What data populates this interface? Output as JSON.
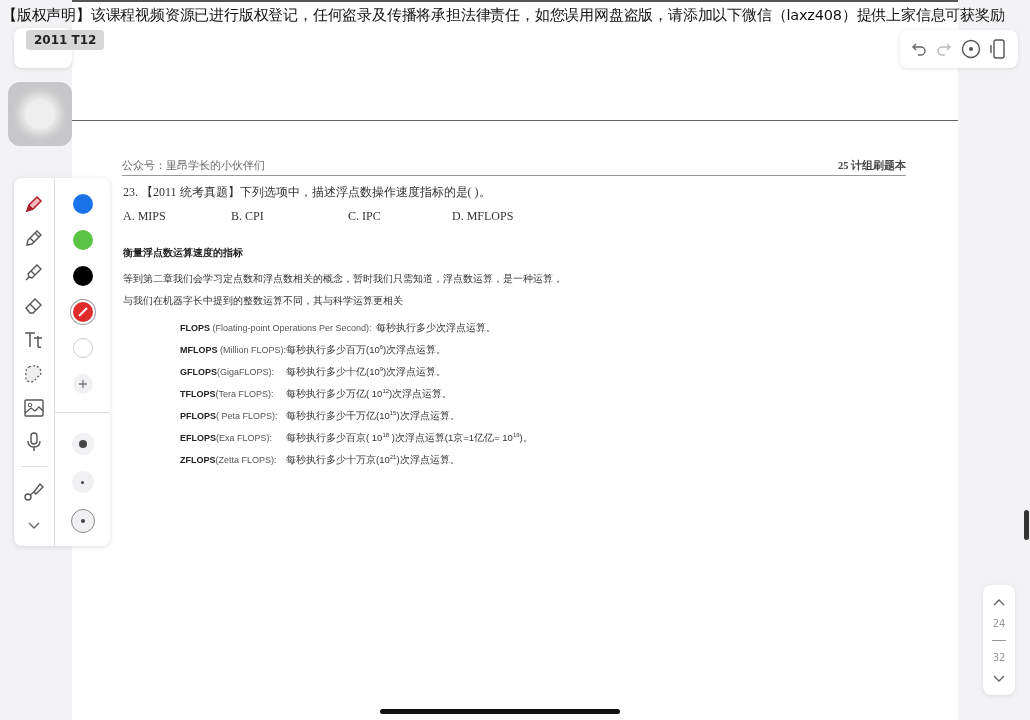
{
  "notice": "【版权声明】该课程视频资源已进行版权登记，任何盗录及传播将承担法律责任，如您误用网盘盗版，请添加以下微信（laxz408）提供上家信息可获奖励",
  "chapter_badge": "2011 T12",
  "document": {
    "header_left": "公众号：里昂学长的小伙伴们",
    "header_right": "25 计组刷题本",
    "question": {
      "number": "23.",
      "text": "【2011 统考真题】下列选项中，描述浮点数操作速度指标的是(     )。"
    },
    "options": [
      "A. MIPS",
      "B. CPI",
      "C. IPC",
      "D. MFLOPS"
    ],
    "section_title": "衡量浮点数运算速度的指标",
    "paragraph": "等到第二章我们会学习定点数和浮点数相关的概念，暂时我们只需知道，浮点数运算，是一种运算，与我们在机器字长中提到的整数运算不同，其与科学运算更相关",
    "definitions": [
      {
        "term": "FLOPS",
        "expansion": " (Floating-point Operations Per Second):",
        "meaning": "每秒执行多少次浮点运算。"
      },
      {
        "term": "MFLOPS",
        "expansion": " (Million FLOPS):",
        "meaning": "每秒执行多少百万(10$^{6}$)次浮点运算。"
      },
      {
        "term": "GFLOPS",
        "expansion": "(GigaFLOPS):",
        "meaning": "每秒执行多少十亿(10$^{9}$)次浮点运算。"
      },
      {
        "term": "TFLOPS",
        "expansion": "(Tera FLOPS):",
        "meaning": "每秒执行多少万亿( 10$^{12}$)次浮点运算。"
      },
      {
        "term": "PFLOPS",
        "expansion": "( Peta FLOPS):",
        "meaning": "每秒执行多少千万亿(10$^{15}$)次浮点运算。"
      },
      {
        "term": "EFLOPS",
        "expansion": "(Exa FLOPS):",
        "meaning": "每秒执行多少百京( 10$^{18}$ )次浮点运算(1京=1亿亿= 10$^{16}$)。"
      },
      {
        "term": "ZFLOPS",
        "expansion": "(Zetta FLOPS):",
        "meaning": "每秒执行多少十万京(10$^{21}$)次浮点运算。"
      }
    ]
  },
  "tools": [
    {
      "kind": "pen",
      "selected": true
    },
    {
      "kind": "pencil",
      "selected": false
    },
    {
      "kind": "highlighter",
      "selected": false
    },
    {
      "kind": "eraser",
      "selected": false
    },
    {
      "kind": "text",
      "selected": false
    },
    {
      "kind": "lasso",
      "selected": false
    },
    {
      "kind": "image",
      "selected": false
    },
    {
      "kind": "mic",
      "selected": false
    },
    {
      "kind": "link",
      "selected": false
    }
  ],
  "colors": [
    {
      "color": "#1a73e8",
      "selected": false
    },
    {
      "color": "#5cc443",
      "selected": false
    },
    {
      "color": "#000000",
      "selected": false
    },
    {
      "color": "#e02b2b",
      "selected": true
    },
    {
      "color": "#ffffff",
      "selected": false
    }
  ],
  "strokes": [
    {
      "kind": "thick",
      "selected": false
    },
    {
      "kind": "thin",
      "selected": false
    },
    {
      "kind": "medium",
      "selected": true
    }
  ],
  "pager": {
    "current": "24",
    "total": "32"
  }
}
